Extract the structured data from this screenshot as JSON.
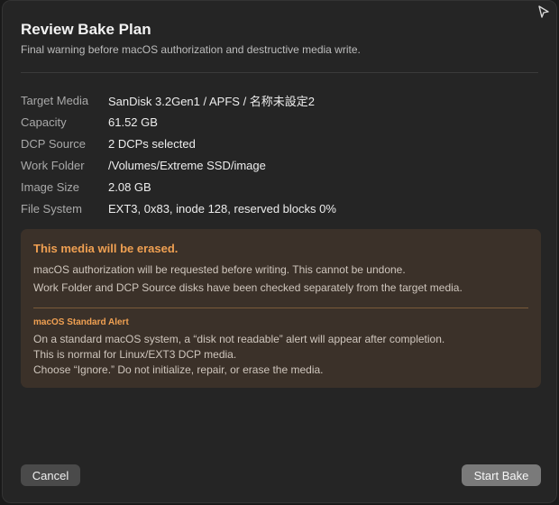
{
  "dialog": {
    "title": "Review Bake Plan",
    "subtitle": "Final warning before macOS authorization and destructive media write."
  },
  "details": [
    {
      "label": "Target Media",
      "value": "SanDisk 3.2Gen1 / APFS / 名称未設定2"
    },
    {
      "label": "Capacity",
      "value": "61.52 GB"
    },
    {
      "label": "DCP Source",
      "value": "2 DCPs selected"
    },
    {
      "label": "Work Folder",
      "value": "/Volumes/Extreme SSD/image"
    },
    {
      "label": "Image Size",
      "value": "2.08 GB"
    },
    {
      "label": "File System",
      "value": "EXT3, 0x83, inode 128, reserved blocks 0%"
    }
  ],
  "warning": {
    "title": "This media will be erased.",
    "lines": [
      "macOS authorization will be requested before writing. This cannot be undone.",
      "Work Folder and DCP Source disks have been checked separately from the target media."
    ],
    "alert_title": "macOS Standard Alert",
    "alert_lines": [
      "On a standard macOS system, a “disk not readable” alert will appear after completion.",
      "This is normal for Linux/EXT3 DCP media.",
      "Choose “Ignore.” Do not initialize, repair, or erase the media."
    ]
  },
  "buttons": {
    "cancel": "Cancel",
    "start": "Start Bake"
  },
  "colors": {
    "background": "#252525",
    "warning_box": "#3b3129",
    "warning_accent": "#f0a052",
    "primary_button": "#7a7a7a",
    "secondary_button": "#4a4a4a"
  },
  "icons": {
    "top_right": "cursor-arrow-icon"
  }
}
